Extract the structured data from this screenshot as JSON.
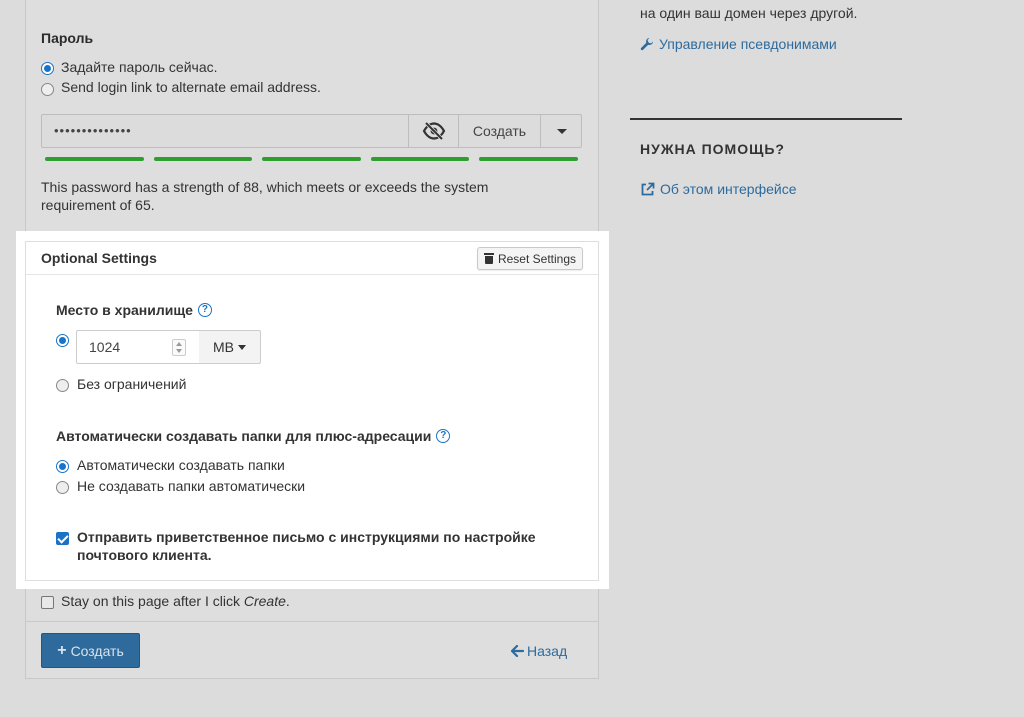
{
  "password_section": {
    "label": "Пароль",
    "options": [
      {
        "label": "Задайте пароль сейчас.",
        "checked": true
      },
      {
        "label": "Send login link to alternate email address.",
        "checked": false
      }
    ],
    "masked_value": "••••••••••••••",
    "generate_label": "Создать",
    "strength_segments": 5,
    "strength_color": "#2f9e2f",
    "strength_text": "This password has a strength of 88, which meets or exceeds the system requirement of 65."
  },
  "optional_settings": {
    "title": "Optional Settings",
    "reset_label": "Reset Settings",
    "storage": {
      "label": "Место в хранилище",
      "value": "1024",
      "unit": "MB",
      "unlimited_label": "Без ограничений",
      "limited_selected": true
    },
    "plus_addressing": {
      "label": "Автоматически создавать папки для плюс-адресации",
      "options": [
        {
          "label": "Автоматически создавать папки",
          "checked": true
        },
        {
          "label": "Не создавать папки автоматически",
          "checked": false
        }
      ]
    },
    "welcome_email": {
      "label": "Отправить приветственное письмо с инструкциями по настройке почтового клиента.",
      "checked": true
    }
  },
  "footer": {
    "stay_label_prefix": "Stay on this page after I click ",
    "stay_label_emph": "Create",
    "stay_label_suffix": ".",
    "create_label": "Создать",
    "back_label": "Назад"
  },
  "sidebar": {
    "intro_text": "на один ваш домен через другой.",
    "alias_link": "Управление псевдонимами",
    "help_heading": "НУЖНА ПОМОЩЬ?",
    "about_link": "Об этом интерфейсе"
  },
  "colors": {
    "accent": "#1a73c7",
    "primary_button": "#2e6a9c",
    "link": "#2d6b9e",
    "overlay": "#dcdcdc"
  }
}
